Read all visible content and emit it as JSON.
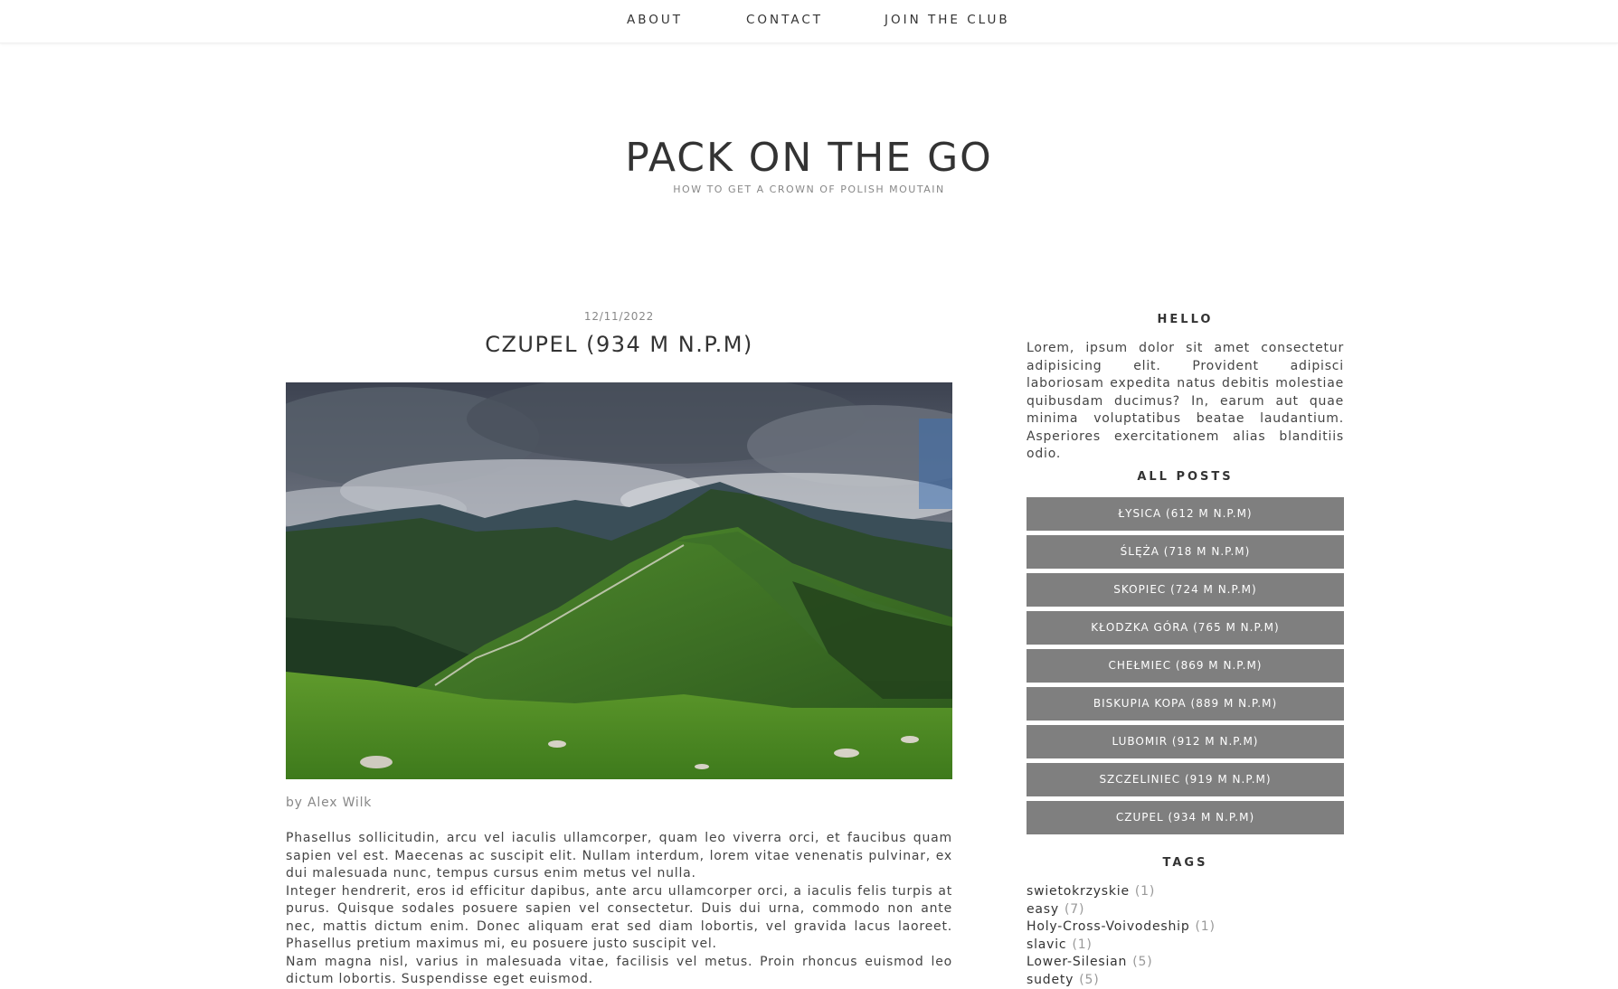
{
  "nav": {
    "about": "ABOUT",
    "contact": "CONTACT",
    "join": "JOIN THE CLUB"
  },
  "site": {
    "title": "PACK ON THE GO",
    "subtitle": "HOW TO GET A CROWN OF POLISH MOUTAIN"
  },
  "post": {
    "date": "12/11/2022",
    "title": "CZUPEL (934 M N.P.M)",
    "author": "by Alex Wilk",
    "paragraphs": [
      "Phasellus sollicitudin, arcu vel iaculis ullamcorper, quam leo viverra orci, et faucibus quam sapien vel est. Maecenas ac suscipit elit. Nullam interdum, lorem vitae venenatis pulvinar, ex dui malesuada nunc, tempus cursus enim metus vel nulla.",
      "Integer hendrerit, eros id efficitur dapibus, ante arcu ullamcorper orci, a iaculis felis turpis at purus. Quisque sodales posuere sapien vel consectetur. Duis dui urna, commodo non ante nec, mattis dictum enim. Donec aliquam erat sed diam lobortis, vel gravida lacus laoreet. Phasellus pretium maximus mi, eu posuere justo suscipit vel.",
      "Nam magna nisl, varius in malesuada vitae, facilisis vel metus. Proin rhoncus euismod leo dictum lobortis. Suspendisse eget euismod."
    ]
  },
  "sidebar": {
    "hello_heading": "HELLO",
    "hello_text": "Lorem, ipsum dolor sit amet consectetur adipisicing elit. Provident adipisci laboriosam expedita natus debitis molestiae quibusdam ducimus? In, earum aut quae minima voluptatibus beatae laudantium. Asperiores exercitationem alias blanditiis odio.",
    "posts_heading": "ALL POSTS",
    "posts": [
      "ŁYSICA (612 M N.P.M)",
      "ŚLĘŻA (718 M N.P.M)",
      "SKOPIEC (724 M N.P.M)",
      "KŁODZKA GÓRA (765 M N.P.M)",
      "CHEŁMIEC (869 M N.P.M)",
      "BISKUPIA KOPA (889 M N.P.M)",
      "LUBOMIR (912 M N.P.M)",
      "SZCZELINIEC (919 M N.P.M)",
      "CZUPEL (934 M N.P.M)"
    ],
    "tags_heading": "TAGS",
    "tags": [
      {
        "name": "swietokrzyskie",
        "count": "(1)"
      },
      {
        "name": "easy",
        "count": "(7)"
      },
      {
        "name": "Holy-Cross-Voivodeship",
        "count": "(1)"
      },
      {
        "name": "slavic",
        "count": "(1)"
      },
      {
        "name": "Lower-Silesian",
        "count": "(5)"
      },
      {
        "name": "sudety",
        "count": "(5)"
      }
    ]
  },
  "colors": {
    "button_bg": "#7f7f7f",
    "text": "#333333",
    "muted": "#888888"
  }
}
